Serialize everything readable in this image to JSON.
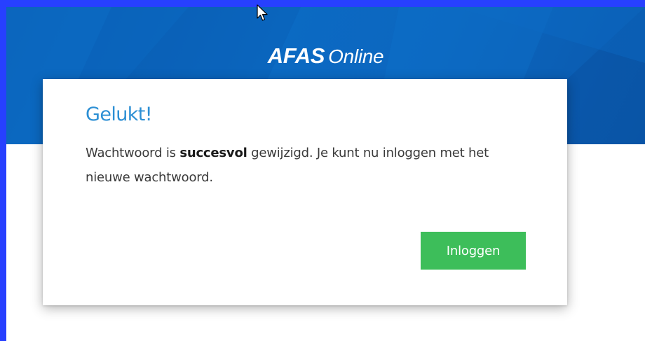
{
  "header": {
    "logo_brand": "AFAS",
    "logo_suffix": "Online"
  },
  "dialog": {
    "title": "Gelukt!",
    "message_part1": "Wachtwoord is ",
    "message_bold": "succesvol",
    "message_part2": " gewijzigd. Je kunt nu inloggen met het nieuwe wachtwoord.",
    "button_label": "Inloggen"
  },
  "colors": {
    "header_blue": "#0b66c0",
    "title_blue": "#2c8fd4",
    "button_green": "#3dbe5a",
    "frame_border": "#2740ff"
  },
  "icons": {
    "cursor": "mouse-pointer-icon"
  }
}
